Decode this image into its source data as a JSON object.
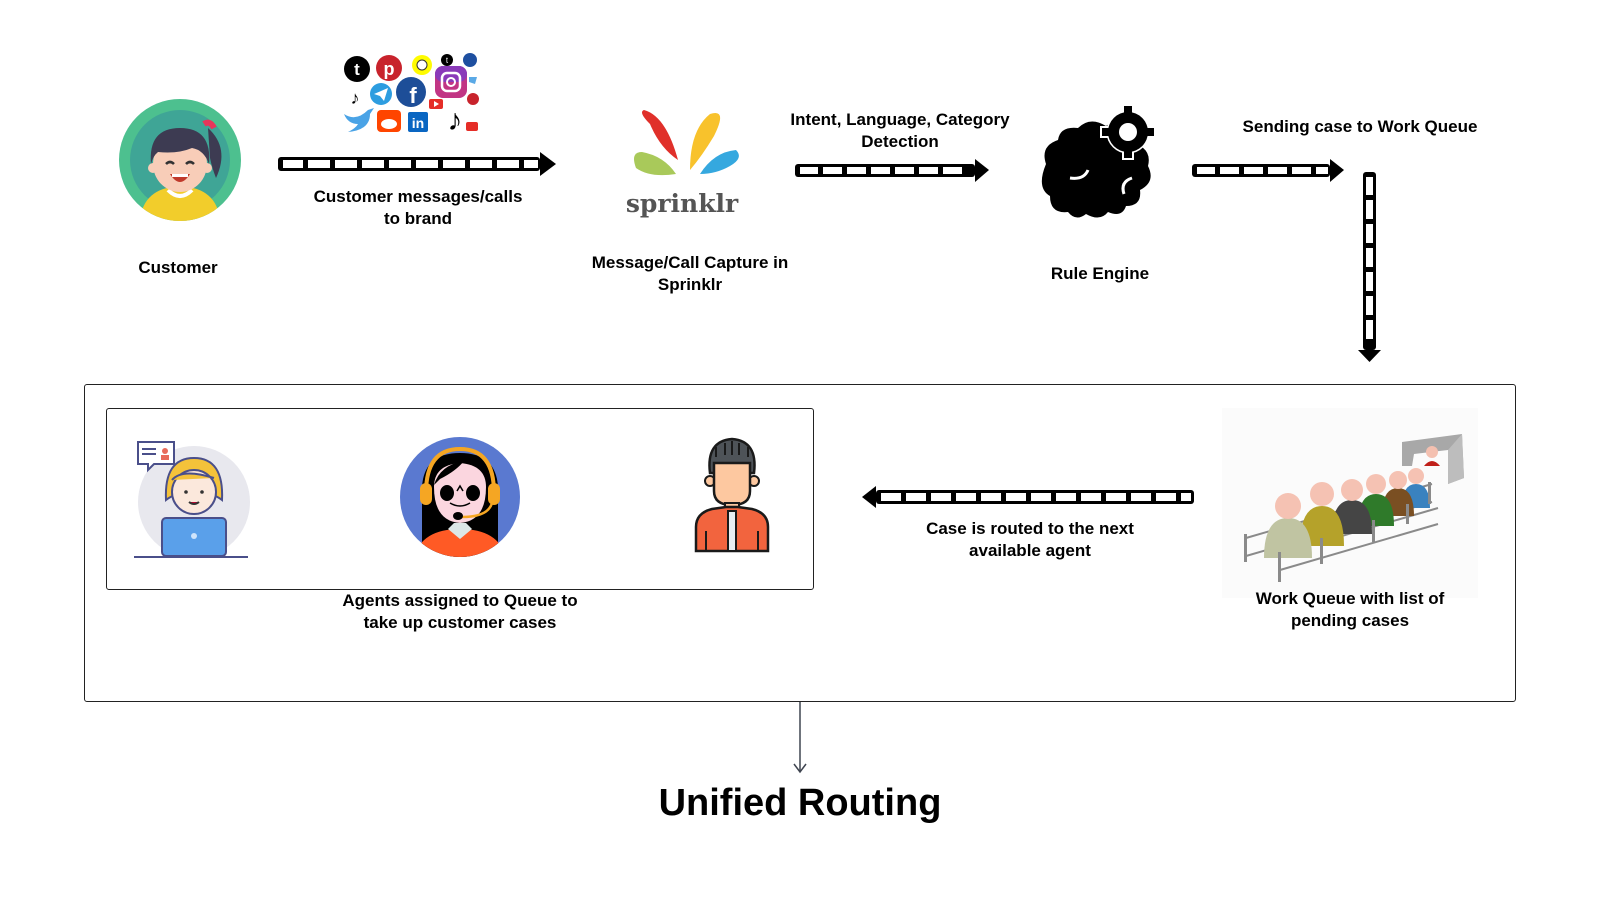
{
  "title": "Unified Routing",
  "nodes": {
    "customer": {
      "label": "Customer",
      "icon": "customer-avatar-icon"
    },
    "social": {
      "icon": "social-media-logos-icon",
      "logos": [
        "tumblr",
        "pinterest",
        "snapchat",
        "tumblr",
        "telegram",
        "tiktok",
        "telegram",
        "facebook",
        "instagram",
        "twitter",
        "youtube",
        "pinterest",
        "twitter",
        "reddit",
        "linkedin",
        "tiktok",
        "youtube"
      ]
    },
    "sprinklr": {
      "logo_text": "sprinklr",
      "label_line1": "Message/Call Capture in",
      "label_line2": "Sprinklr"
    },
    "rule_engine": {
      "label": "Rule Engine",
      "icon": "brain-gear-icon"
    },
    "work_queue": {
      "label_line1": "Work Queue with list of",
      "label_line2": "pending cases",
      "icon": "queue-people-icon"
    },
    "agents": {
      "label_line1": "Agents assigned to Queue to",
      "label_line2": "take up customer cases",
      "icons": [
        "agent-laptop-icon",
        "agent-headset-icon",
        "agent-male-icon"
      ]
    }
  },
  "edges": {
    "customer_to_sprinklr": {
      "line1": "Customer messages/calls",
      "line2": "to brand"
    },
    "sprinklr_to_rule": {
      "line1": "Intent, Language, Category",
      "line2": "Detection"
    },
    "rule_to_queue": {
      "line1": "Sending case to Work Queue"
    },
    "queue_to_agent": {
      "line1": "Case is routed to the next",
      "line2": "available agent"
    }
  },
  "colors": {
    "customer_ring": "#4dc08f",
    "customer_inner": "#3fa596",
    "sprinklr_red": "#e0302a",
    "sprinklr_yellow": "#f8c22c",
    "sprinklr_green": "#a9c95a",
    "sprinklr_blue": "#35a8df",
    "agent_blue": "#5a79d0",
    "agent_orange": "#ff5a25"
  }
}
